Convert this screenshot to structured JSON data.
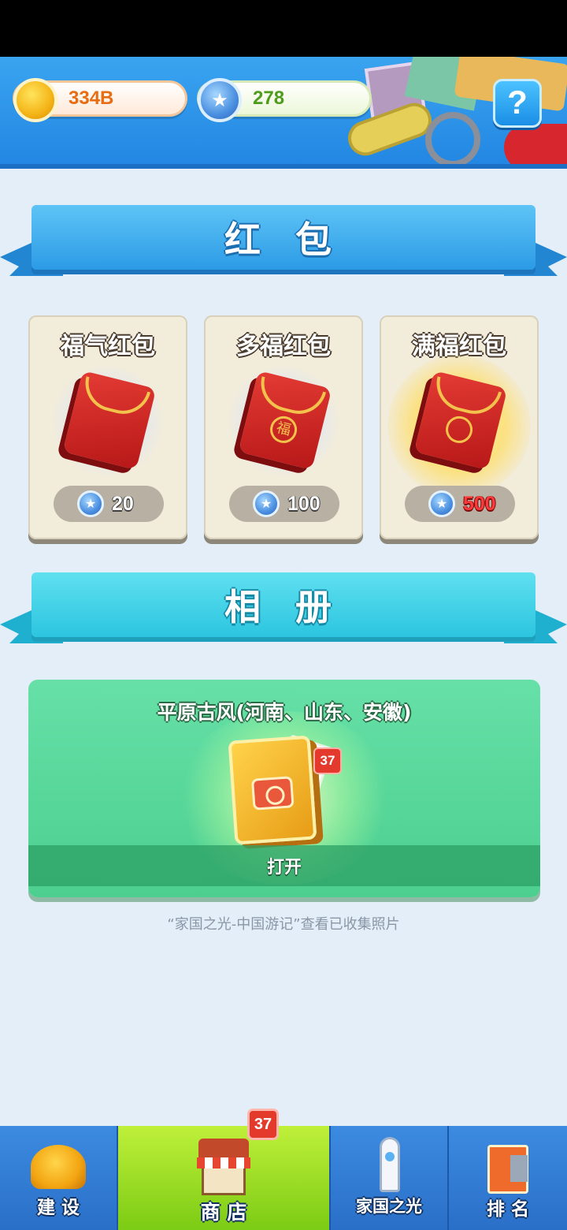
{
  "currency": {
    "coins": "334B",
    "gems": "278",
    "help_label": "?"
  },
  "sections": {
    "red_packet_title": "红 包",
    "album_title": "相 册"
  },
  "red_packets": [
    {
      "name": "福气红包",
      "price": "20",
      "style": "normal"
    },
    {
      "name": "多福红包",
      "price": "100",
      "style": "normal"
    },
    {
      "name": "满福红包",
      "price": "500",
      "style": "gold"
    }
  ],
  "album": {
    "name": "平原古风(河南、山东、安徽)",
    "badge": "37",
    "open_label": "打开",
    "caption": "“家国之光-中国游记”查看已收集照片"
  },
  "nav": {
    "items": [
      {
        "label": "建 设",
        "icon": "hard-hat-icon"
      },
      {
        "label": "商 店",
        "icon": "shop-icon"
      },
      {
        "label": "家国之光",
        "icon": "rocket-icon"
      },
      {
        "label": "排 名",
        "icon": "tower-icon"
      }
    ],
    "shop_badge": "37"
  },
  "colors": {
    "header_blue": "#2387e3",
    "active_tab_green": "#7ccb14",
    "badge_red": "#e33a2c",
    "coin_text": "#e86c12",
    "gem_text": "#4f9b1c"
  }
}
